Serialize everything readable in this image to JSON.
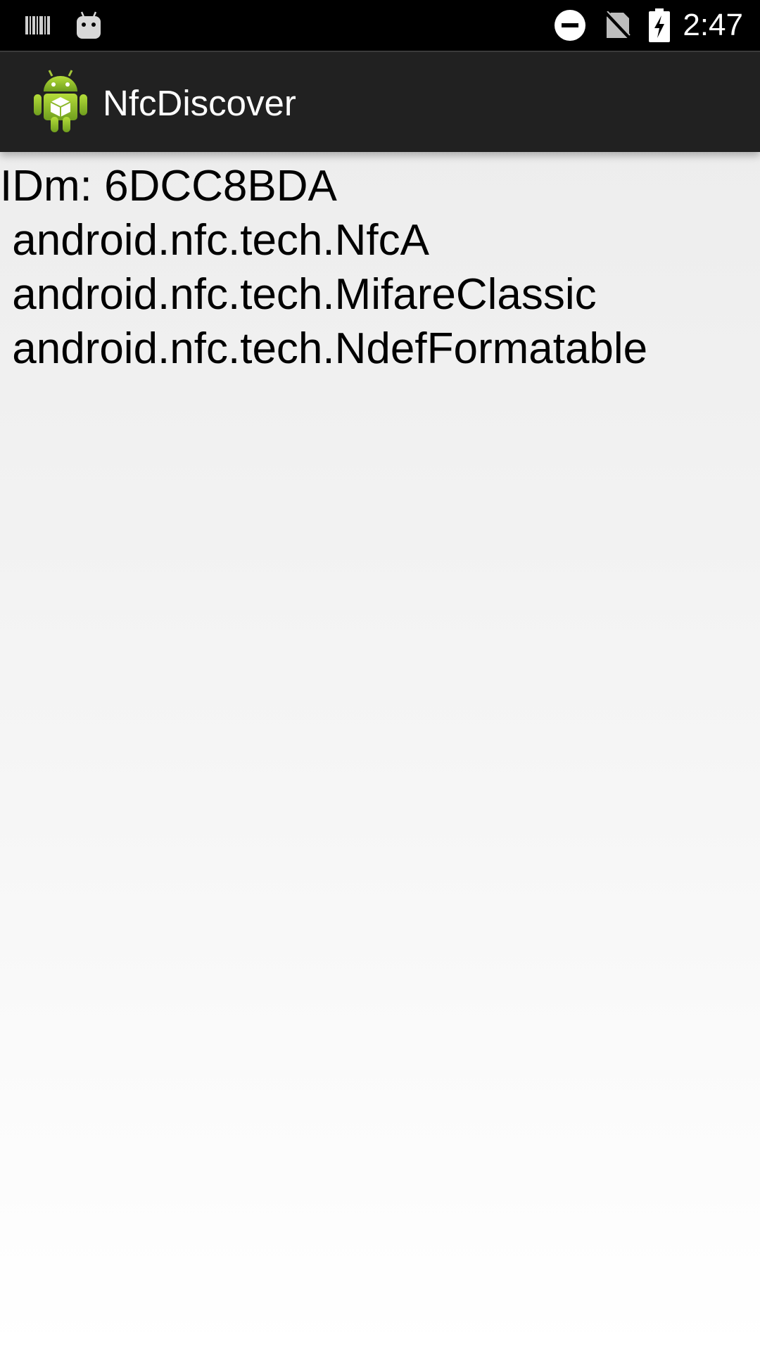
{
  "status_bar": {
    "time": "2:47",
    "icons": [
      "barcode-icon",
      "android-debug-icon",
      "do-not-disturb-icon",
      "no-sim-icon",
      "battery-charging-icon"
    ]
  },
  "app_bar": {
    "title": "NfcDiscover",
    "icon": "android-app-icon"
  },
  "content": {
    "lines": [
      "IDm: 6DCC8BDA",
      " android.nfc.tech.NfcA",
      " android.nfc.tech.MifareClassic",
      " android.nfc.tech.NdefFormatable"
    ]
  },
  "colors": {
    "status_bar_bg": "#000000",
    "app_bar_bg": "#212121",
    "text": "#000000"
  }
}
